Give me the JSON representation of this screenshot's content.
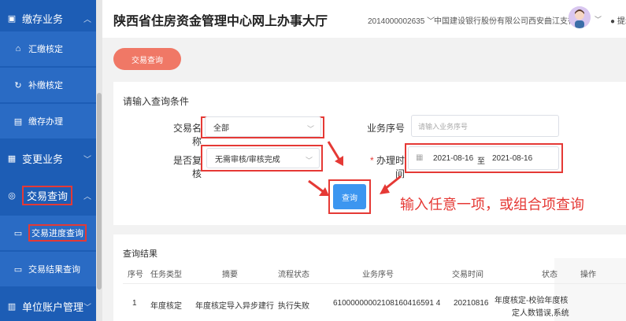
{
  "sidebar": {
    "items": [
      {
        "label": "缴存业务",
        "icon": "deposit-icon"
      },
      {
        "label": "汇缴核定",
        "icon": "home-icon"
      },
      {
        "label": "补缴核定",
        "icon": "refresh-icon"
      },
      {
        "label": "缴存办理",
        "icon": "document-icon"
      },
      {
        "label": "变更业务",
        "icon": "clipboard-icon"
      },
      {
        "label": "交易查询",
        "icon": "search-icon"
      },
      {
        "label": "交易进度查询",
        "icon": "progress-icon"
      },
      {
        "label": "交易结果查询",
        "icon": "result-icon"
      },
      {
        "label": "单位账户管理",
        "icon": "building-icon"
      }
    ]
  },
  "header": {
    "title": "陕西省住房资金管理中心网上办事大厅",
    "account": "2014000002635",
    "bank": "中国建设银行股份有限公司西安曲江支行",
    "tip": "提示"
  },
  "tab": {
    "label": "交易查询"
  },
  "query": {
    "title": "请输入查询条件",
    "trade_name_label": "交易名称",
    "trade_name_value": "全部",
    "biz_no_label": "业务序号",
    "biz_no_placeholder": "请输入业务序号",
    "review_label": "是否复核",
    "review_value": "无需审核/审核完成",
    "time_label": "办理时间",
    "required_mark": "*",
    "date_from": "2021-08-16",
    "date_sep": "至",
    "date_to": "2021-08-16",
    "button": "查询"
  },
  "annotation": "输入任意一项，或组合项查询",
  "results": {
    "title": "查询结果",
    "headers": [
      "序号",
      "任务类型",
      "摘要",
      "流程状态",
      "业务序号",
      "交易时间",
      "状态",
      "操作"
    ],
    "row": {
      "no": "1",
      "type": "年度核定",
      "summary": "年度核定导入异步建行",
      "flow": "执行失败",
      "biz_no": "61000000002108160416591 4",
      "time": "20210816",
      "status_line1": "年度核定-校验年度核",
      "status_line2": "定人数错误,系统"
    }
  },
  "colors": {
    "sidebar_bg": "#1d5db5",
    "accent_red": "#e53935",
    "tab_orange": "#f07866",
    "button_blue": "#3c96f0"
  }
}
